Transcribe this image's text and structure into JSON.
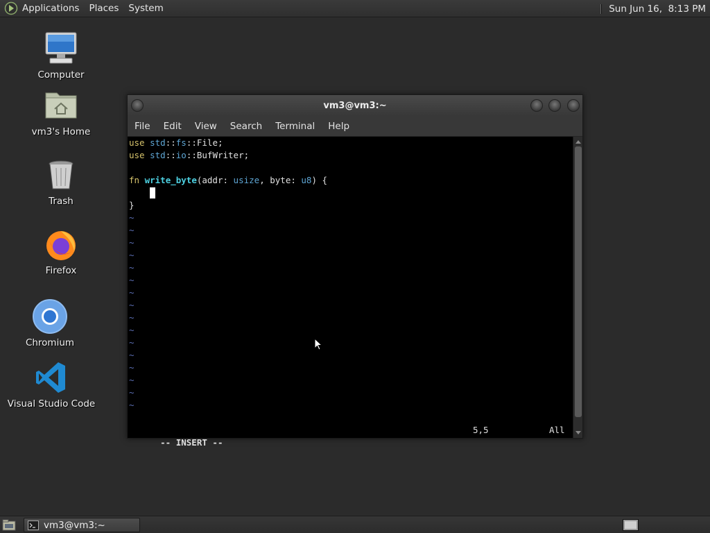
{
  "top_panel": {
    "menus": [
      "Applications",
      "Places",
      "System"
    ],
    "clock": "Sun Jun 16,  8:13 PM"
  },
  "desktop": {
    "icons": [
      {
        "label": "Computer",
        "icon": "computer-icon"
      },
      {
        "label": "vm3's Home",
        "icon": "home-folder-icon"
      },
      {
        "label": "Trash",
        "icon": "trash-icon"
      },
      {
        "label": "Firefox",
        "icon": "firefox-icon"
      },
      {
        "label": "Chromium",
        "icon": "chromium-icon"
      },
      {
        "label": "Visual Studio Code",
        "icon": "vscode-icon"
      }
    ]
  },
  "terminal": {
    "title": "vm3@vm3:~",
    "menu": [
      "File",
      "Edit",
      "View",
      "Search",
      "Terminal",
      "Help"
    ],
    "code": {
      "line1": {
        "kw": "use",
        "p1": "std",
        "sep1": "::",
        "p2": "fs",
        "sep2": "::",
        "rest": "File;"
      },
      "line2": {
        "kw": "use",
        "p1": "std",
        "sep1": "::",
        "p2": "io",
        "sep2": "::",
        "rest": "BufWriter;"
      },
      "line4": {
        "kw": "fn",
        "name": "write_byte",
        "open": "(addr: ",
        "t1": "usize",
        "mid": ", byte: ",
        "t2": "u8",
        "close": ") {"
      },
      "line6": "}",
      "tilde": "~"
    },
    "status": {
      "mode": "-- INSERT --",
      "position": "5,5",
      "scroll": "All"
    }
  },
  "taskbar": {
    "task_label": "vm3@vm3:~"
  },
  "colors": {
    "keyword": "#d6c36b",
    "path": "#5fa7d6",
    "function": "#4dd0e1",
    "tilde": "#5c6fb5"
  }
}
